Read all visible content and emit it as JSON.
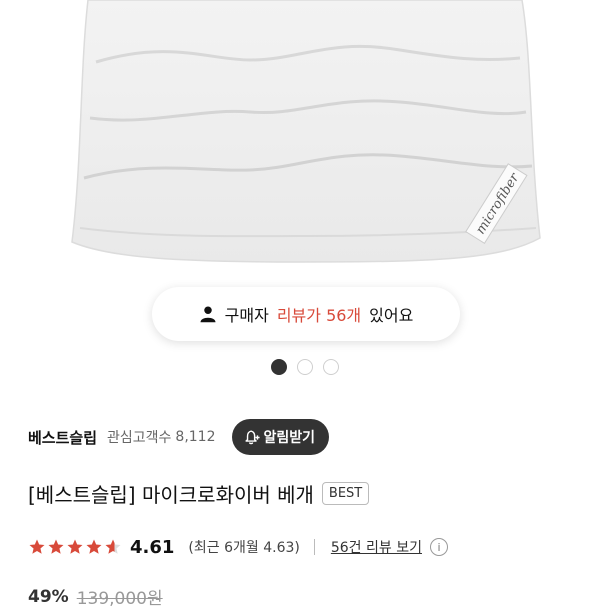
{
  "product_image": {
    "label_text": "microfiber"
  },
  "review_pill": {
    "prefix": "구매자",
    "highlight": "리뷰가 56개",
    "suffix": "있어요",
    "highlight_color": "#d84a3a"
  },
  "carousel": {
    "dots": [
      "active",
      "inactive",
      "inactive"
    ]
  },
  "seller": {
    "name": "베스트슬립",
    "follow_label": "관심고객수",
    "follow_count": "8,112",
    "alarm_button": "알림받기"
  },
  "product": {
    "title": "[베스트슬립] 마이크로화이버 베개",
    "badge": "BEST"
  },
  "rating": {
    "score": "4.61",
    "stars": 4.61,
    "recent": "(최근 6개월 4.63)",
    "review_link": "56건 리뷰 보기",
    "info_icon": "i",
    "star_color": "#d84a3a"
  },
  "price": {
    "discount": "49%",
    "original": "139,000원"
  }
}
